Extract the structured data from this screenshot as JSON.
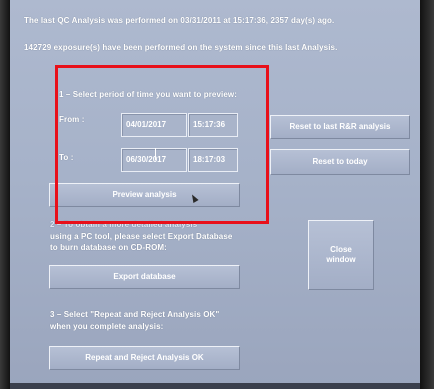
{
  "info": {
    "last_analysis": "The last QC Analysis was performed on 03/31/2011 at 15:17:36, 2357 day(s) ago.",
    "exposures": "142729 exposure(s) have been performed on the system since this last Analysis."
  },
  "step1": {
    "title": "1 – Select period of time you want to preview:",
    "from_label": "From :",
    "from_date": "04/01/2017",
    "from_time": "15:17:36",
    "to_label": "To :",
    "to_date": "06/30/2017",
    "to_time": "18:17:03",
    "preview_button": "Preview analysis"
  },
  "right_buttons": {
    "reset_rr": "Reset to last R&R analysis",
    "reset_today": "Reset to today",
    "close": "Close window"
  },
  "step2": {
    "partial": "2 – To obtain a more detailed analysis",
    "line1": "using a PC tool, please select Export Database",
    "line2": "to burn database on CD-ROM:",
    "export_button": "Export database"
  },
  "step3": {
    "line1": "3 – Select \"Repeat and Reject Analysis OK\"",
    "line2": "when you complete analysis:",
    "ok_button": "Repeat and Reject Analysis OK"
  },
  "colors": {
    "screen_bg": "#a6b2c9",
    "highlight": "#e8101a"
  }
}
